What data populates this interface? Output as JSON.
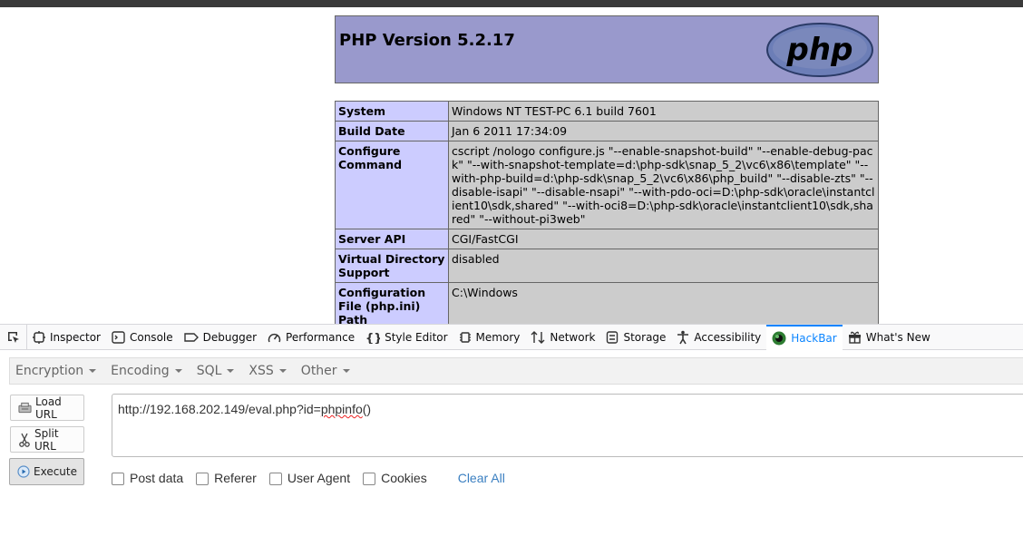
{
  "php_page": {
    "title": "PHP Version 5.2.17",
    "logo_text": "php",
    "rows": [
      {
        "key": "System",
        "value": "Windows NT TEST-PC 6.1 build 7601"
      },
      {
        "key": "Build Date",
        "value": "Jan 6 2011 17:34:09"
      },
      {
        "key": "Configure Command",
        "value": "cscript /nologo configure.js \"--enable-snapshot-build\" \"--enable-debug-pack\" \"--with-snapshot-template=d:\\php-sdk\\snap_5_2\\vc6\\x86\\template\" \"--with-php-build=d:\\php-sdk\\snap_5_2\\vc6\\x86\\php_build\" \"--disable-zts\" \"--disable-isapi\" \"--disable-nsapi\" \"--with-pdo-oci=D:\\php-sdk\\oracle\\instantclient10\\sdk,shared\" \"--with-oci8=D:\\php-sdk\\oracle\\instantclient10\\sdk,shared\" \"--without-pi3web\""
      },
      {
        "key": "Server API",
        "value": "CGI/FastCGI"
      },
      {
        "key": "Virtual Directory Support",
        "value": "disabled"
      },
      {
        "key": "Configuration File (php.ini) Path",
        "value": "C:\\Windows"
      }
    ]
  },
  "devtools": {
    "tabs": [
      {
        "label": "Inspector",
        "icon": "inspector-icon"
      },
      {
        "label": "Console",
        "icon": "console-icon"
      },
      {
        "label": "Debugger",
        "icon": "debugger-icon"
      },
      {
        "label": "Performance",
        "icon": "performance-icon"
      },
      {
        "label": "Style Editor",
        "icon": "style-editor-icon"
      },
      {
        "label": "Memory",
        "icon": "memory-icon"
      },
      {
        "label": "Network",
        "icon": "network-icon"
      },
      {
        "label": "Storage",
        "icon": "storage-icon"
      },
      {
        "label": "Accessibility",
        "icon": "accessibility-icon"
      },
      {
        "label": "HackBar",
        "icon": "hackbar-icon"
      },
      {
        "label": "What's New",
        "icon": "gift-icon"
      }
    ],
    "selected_tab": "HackBar",
    "accent_color": "#0a84ff"
  },
  "hackbar": {
    "menu": [
      "Encryption",
      "Encoding",
      "SQL",
      "XSS",
      "Other"
    ],
    "buttons": {
      "load": "Load URL",
      "split": "Split URL",
      "execute": "Execute"
    },
    "url_prefix": "http://192.168.202.149/eval.php?id=",
    "url_suffix": "phpinfo",
    "url_end": "()",
    "options": [
      "Post data",
      "Referer",
      "User Agent",
      "Cookies"
    ],
    "clear_all": "Clear All"
  }
}
